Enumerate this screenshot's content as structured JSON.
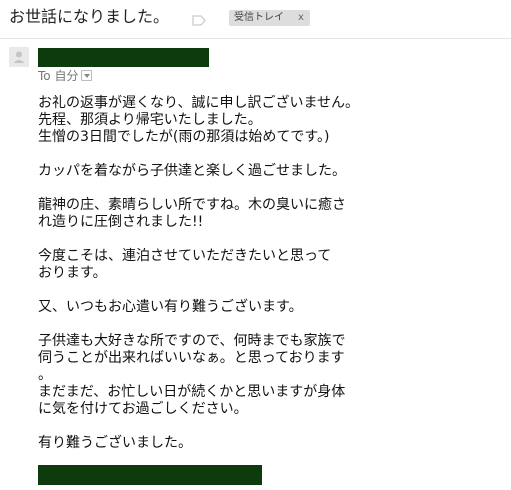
{
  "header": {
    "subject": "お世話になりました。",
    "label": "受信トレイ",
    "label_remove": "x"
  },
  "sender": {
    "to_prefix": "To",
    "to_name": "自分"
  },
  "body": {
    "paragraphs": [
      [
        "お礼の返事が遅くなり、誠に申し訳ございません。",
        "先程、那須より帰宅いたしました。",
        "生憎の3日間でしたが(雨の那須は始めてです。)"
      ],
      [
        "カッパを着ながら子供達と楽しく過ごせました。"
      ],
      [
        "龍神の庄、素晴らしい所ですね。木の臭いに癒さ",
        "れ造りに圧倒されました!!"
      ],
      [
        "今度こそは、連泊させていただきたいと思って",
        "おります。"
      ],
      [
        "又、いつもお心遣い有り難うございます。"
      ],
      [
        "子供達も大好きな所ですので、何時までも家族で",
        "伺うことが出来ればいいなぁ。と思っております",
        "。",
        "まだまだ、お忙しい日が続くかと思いますが身体",
        "に気を付けてお過ごしください。"
      ],
      [
        "有り難うございました。"
      ]
    ]
  },
  "colors": {
    "redaction": "#0d3b0d",
    "label_chip_bg": "#dddddd"
  },
  "icons": {
    "label_tag": "label-tag-icon",
    "avatar": "person-avatar-icon",
    "dropdown": "chevron-down-icon"
  }
}
